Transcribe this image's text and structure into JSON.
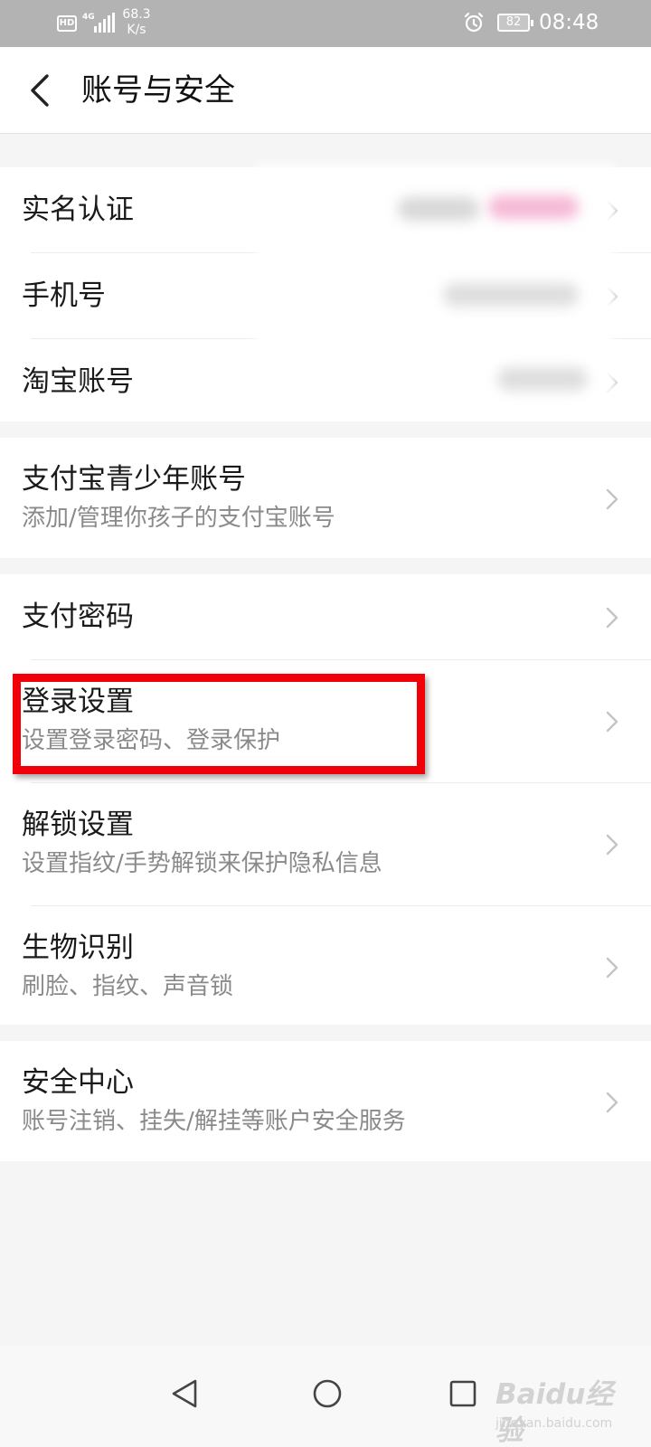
{
  "status_bar": {
    "hd": "HD",
    "network": "4G",
    "speed_value": "68.3",
    "speed_unit": "K/s",
    "battery": "82",
    "time": "08:48",
    "icons": [
      "signal-icon",
      "alarm-icon",
      "battery-icon"
    ]
  },
  "header": {
    "title": "账号与安全",
    "back_icon": "chevron-left-icon"
  },
  "groups": [
    {
      "items": [
        {
          "title": "实名认证"
        },
        {
          "title": "手机号"
        },
        {
          "title": "淘宝账号"
        }
      ]
    },
    {
      "items": [
        {
          "title": "支付宝青少年账号",
          "subtitle": "添加/管理你孩子的支付宝账号"
        }
      ]
    },
    {
      "items": [
        {
          "title": "支付密码"
        },
        {
          "title": "登录设置",
          "subtitle": "设置登录密码、登录保护"
        },
        {
          "title": "解锁设置",
          "subtitle": "设置指纹/手势解锁来保护隐私信息"
        },
        {
          "title": "生物识别",
          "subtitle": "刷脸、指纹、声音锁"
        }
      ]
    },
    {
      "items": [
        {
          "title": "安全中心",
          "subtitle": "账号注销、挂失/解挂等账户安全服务"
        }
      ]
    }
  ],
  "highlight_target": "登录设置",
  "colors": {
    "status_bar_bg": "#b3b3b3",
    "page_bg": "#f5f5f5",
    "highlight": "#f2000a",
    "subtitle": "#8a8a8a",
    "chevron": "#c4c4c4"
  },
  "watermark": {
    "logo": "Baidu经验",
    "url": "jingyan.baidu.com"
  }
}
